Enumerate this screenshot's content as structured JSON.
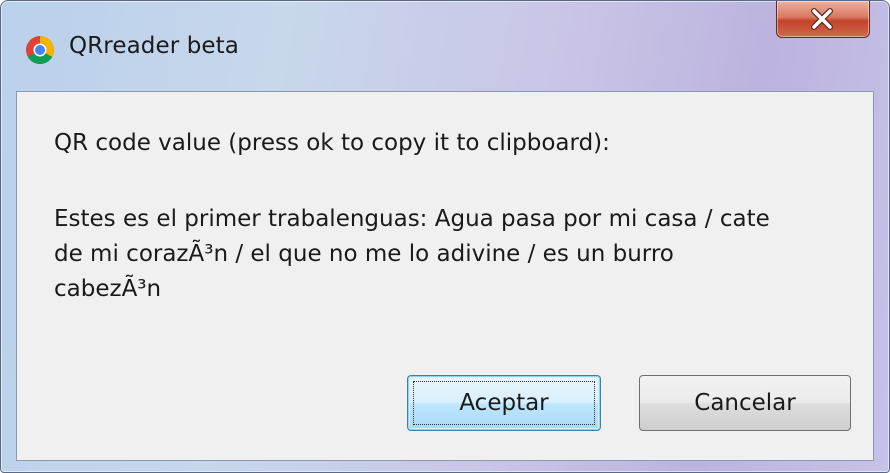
{
  "window": {
    "title": "QRreader beta",
    "icon": "chrome-icon",
    "close_icon": "close-icon"
  },
  "dialog": {
    "prompt": "QR code value (press ok to copy it to clipboard):",
    "value": "Estes es el primer trabalenguas: Agua pasa por mi casa / cate\nde mi corazÃ³n / el que no me lo adivine / es un burro\ncabezÃ³n"
  },
  "buttons": {
    "ok_label": "Aceptar",
    "cancel_label": "Cancelar"
  },
  "colors": {
    "close_button": "#c3432a",
    "default_button_border": "#3c7fb1"
  }
}
